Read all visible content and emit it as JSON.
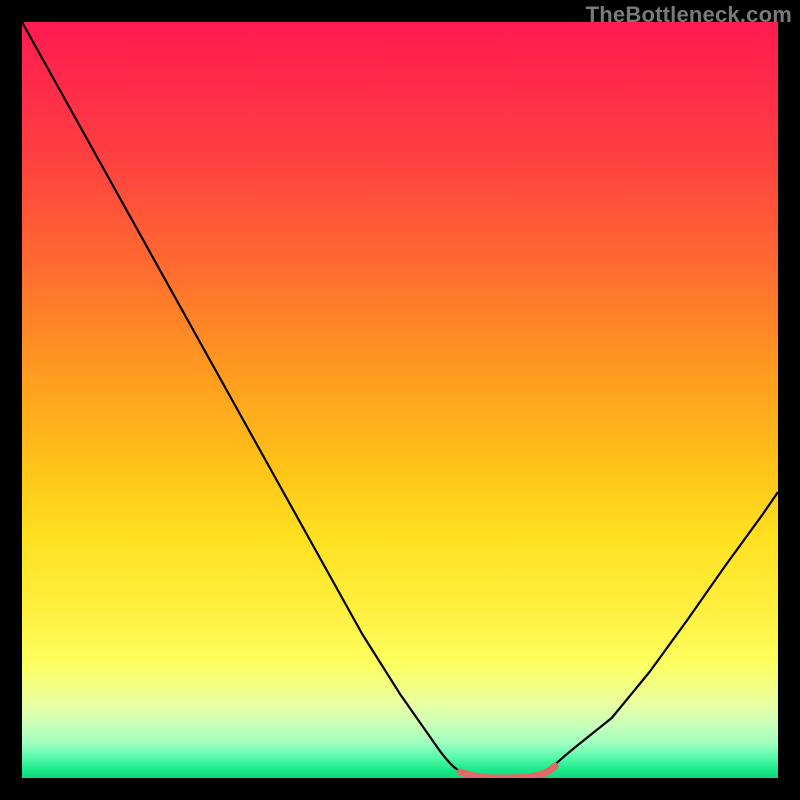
{
  "watermark": "TheBottleneck.com",
  "chart_data": {
    "type": "line",
    "title": "",
    "xlabel": "",
    "ylabel": "",
    "xlim": [
      0,
      100
    ],
    "ylim": [
      0,
      100
    ],
    "grid": false,
    "x": [
      0,
      5,
      10,
      15,
      20,
      25,
      30,
      35,
      40,
      45,
      50,
      55,
      58,
      60,
      64,
      68,
      70,
      73,
      78,
      83,
      88,
      93,
      98,
      100
    ],
    "values": [
      100,
      91,
      82,
      73,
      64,
      55,
      46,
      37,
      28,
      19,
      11,
      4,
      1,
      0,
      0,
      0,
      1,
      3,
      8,
      14,
      21,
      28,
      35,
      38
    ],
    "highlight_segment": {
      "x_start": 58,
      "x_end": 70,
      "color": "#de6b67"
    },
    "background_gradient": [
      "#ff1a50",
      "#ffe020",
      "#0fd67e"
    ]
  }
}
